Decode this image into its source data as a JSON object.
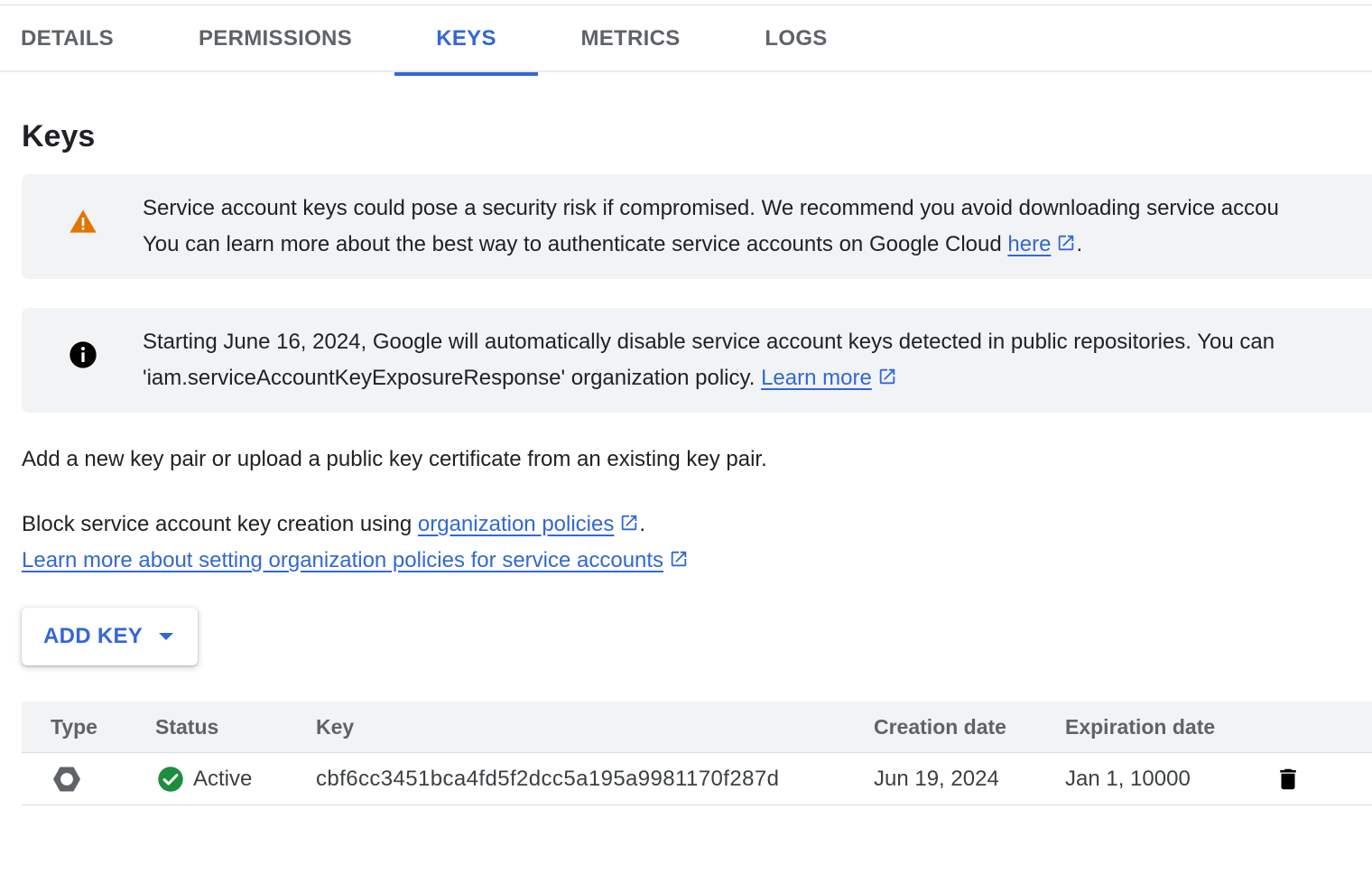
{
  "tabs": [
    {
      "label": "DETAILS",
      "active": false
    },
    {
      "label": "PERMISSIONS",
      "active": false
    },
    {
      "label": "KEYS",
      "active": true
    },
    {
      "label": "METRICS",
      "active": false
    },
    {
      "label": "LOGS",
      "active": false
    }
  ],
  "page": {
    "title": "Keys"
  },
  "warning_banner": {
    "icon": "warning-triangle-icon",
    "line1": "Service account keys could pose a security risk if compromised. We recommend you avoid downloading service accou",
    "line2_prefix": "You can learn more about the best way to authenticate service accounts on Google Cloud ",
    "link_label": "here",
    "line2_suffix": "."
  },
  "info_banner": {
    "icon": "info-icon",
    "line1": "Starting June 16, 2024, Google will automatically disable service account keys detected in public repositories. You can",
    "line2_prefix": "'iam.serviceAccountKeyExposureResponse' organization policy. ",
    "link_label": "Learn more"
  },
  "intro_text": "Add a new key pair or upload a public key certificate from an existing key pair.",
  "block_text": {
    "prefix": "Block service account key creation using ",
    "link_label": "organization policies",
    "suffix": "."
  },
  "learn_more_link": "Learn more about setting organization policies for service accounts",
  "add_key_button": {
    "label": "ADD KEY"
  },
  "keys_table": {
    "headers": {
      "type": "Type",
      "status": "Status",
      "key": "Key",
      "creation_date": "Creation date",
      "expiration_date": "Expiration date"
    },
    "rows": [
      {
        "type_icon": "key-type-hexagon-icon",
        "status": "Active",
        "key": "cbf6cc3451bca4fd5f2dcc5a195a9981170f287d",
        "creation_date": "Jun 19, 2024",
        "expiration_date": "Jan 1, 10000"
      }
    ]
  },
  "colors": {
    "accent": "#3367d6",
    "warning": "#e37400",
    "success": "#1e8e3e",
    "banner_bg": "#f1f3f4"
  }
}
